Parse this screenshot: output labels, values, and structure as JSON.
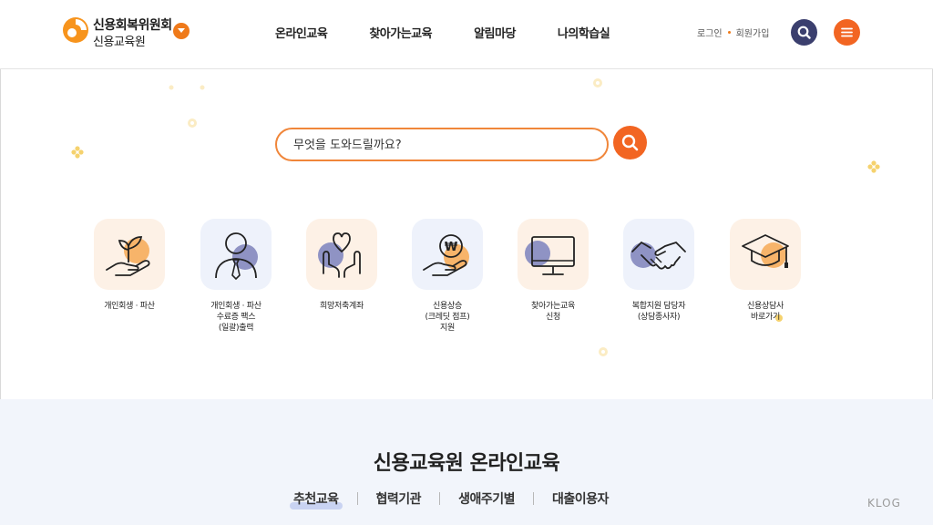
{
  "header": {
    "logo": {
      "line1": "신용회복위원회",
      "line2": "신용교육원"
    },
    "nav": [
      {
        "label": "온라인교육"
      },
      {
        "label": "찾아가는교육"
      },
      {
        "label": "알림마당"
      },
      {
        "label": "나의학습실"
      }
    ],
    "util": {
      "login": "로그인",
      "signup": "회원가입"
    },
    "colors": {
      "accent": "#f26522",
      "navy": "#3b3f6e"
    }
  },
  "search": {
    "placeholder": "무엇을 도와드릴까요?",
    "icon": "search-icon"
  },
  "quick_menu": [
    {
      "lines": [
        "개인회생 · 파산"
      ],
      "icon": "hand-plant-icon"
    },
    {
      "lines": [
        "개인회생 · 파산",
        "수료증 팩스",
        "(일괄)출력"
      ],
      "icon": "person-tie-icon"
    },
    {
      "lines": [
        "희망저축계좌"
      ],
      "icon": "hands-heart-icon"
    },
    {
      "lines": [
        "신용상승",
        "(크레딧 점프)",
        "지원"
      ],
      "icon": "coin-hand-icon"
    },
    {
      "lines": [
        "찾아가는교육",
        "신청"
      ],
      "icon": "monitor-icon"
    },
    {
      "lines": [
        "복합지원 담당자",
        "(상담종사자)"
      ],
      "icon": "handshake-icon"
    },
    {
      "lines": [
        "신용상담사",
        "바로가기"
      ],
      "icon": "graduation-cap-icon"
    }
  ],
  "section": {
    "title": "신용교육원 온라인교육",
    "tabs": [
      {
        "label": "추천교육"
      },
      {
        "label": "협력기관"
      },
      {
        "label": "생애주기별"
      },
      {
        "label": "대출이용자"
      }
    ]
  },
  "watermark": "KLOG"
}
